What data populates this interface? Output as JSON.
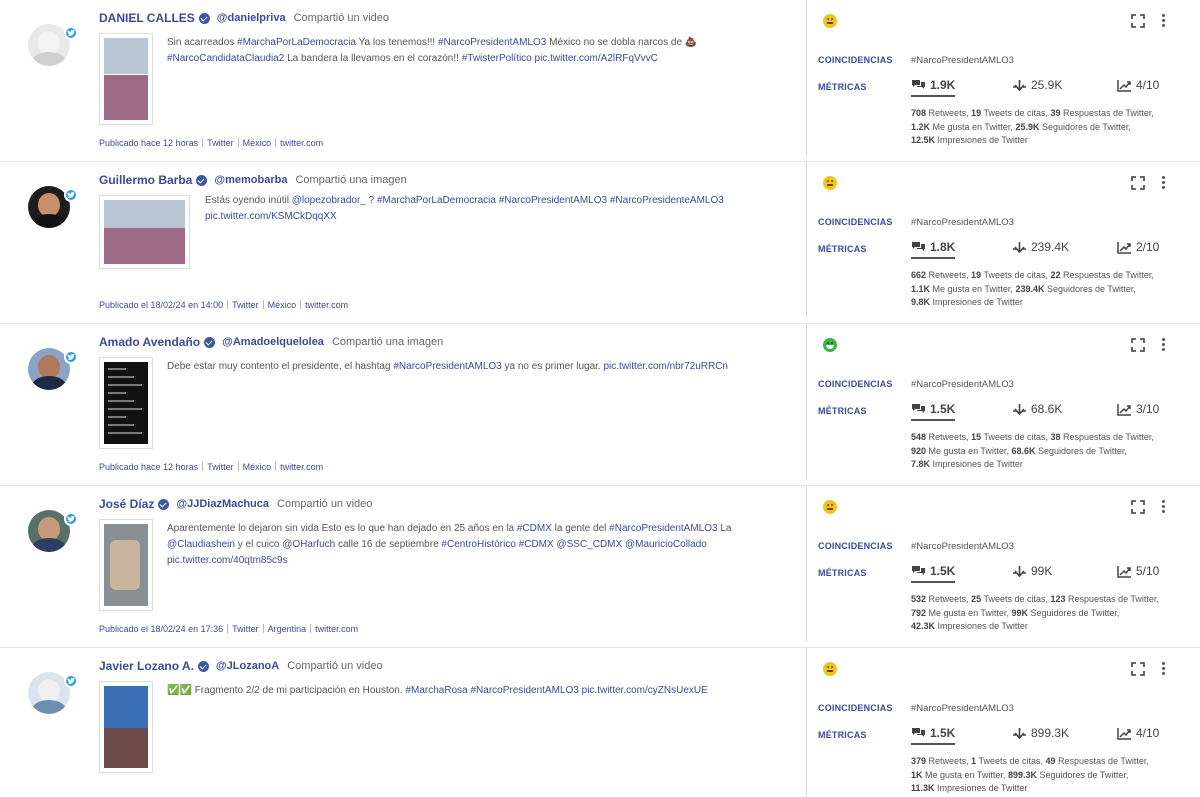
{
  "labels": {
    "coincidencias": "COINCIDENCIAS",
    "metricas": "MÉTRICAS",
    "retweets": "Retweets",
    "quotes": "Tweets de citas",
    "replies": "Respuestas de Twitter",
    "likes": "Me gusta en Twitter",
    "followers": "Seguidores de Twitter",
    "impressions": "Impresiones de Twitter"
  },
  "icons": {
    "comments": "comments-icon",
    "reach": "reach-icon",
    "trend": "trend-icon",
    "expand": "expand-icon",
    "menu": "more-vertical-icon"
  },
  "posts": [
    {
      "author": "DANIEL CALLES",
      "handle": "@danielpriva",
      "action": "Compartió un video",
      "text": "Sin acarreados #MarchaPorLaDemocracia Ya los tenemos!!! #NarcoPresidentAMLO3 México no se dobla narcos de 💩 #NarcoCandidataClaudia2 La bandera la llevamos en el corazón!! #TwisterPolítico pic.twitter.com/A2lRFqVvvC",
      "published": "Publicado hace 12 horas",
      "source": "Twitter",
      "country": "México",
      "domain": "twitter.com",
      "sentiment": "neutral",
      "coincidence": "#NarcoPresidentAMLO3",
      "comments": "1.9K",
      "reach": "25.9K",
      "score": "4/10",
      "retweets": "708",
      "quotes": "19",
      "replies": "39",
      "likes": "1.2K",
      "followers": "25.9K",
      "impressions": "12.5K"
    },
    {
      "author": "Guillermo Barba",
      "handle": "@memobarba",
      "action": "Compartió una imagen",
      "text": "Estás oyendo inútil @lopezobrador_ ? #MarchaPorLaDemocracia #NarcoPresidentAMLO3 #NarcoPresidenteAMLO3 pic.twitter.com/KSMCkDqqXX",
      "published": "Publicado el 18/02/24 en 14:00",
      "source": "Twitter",
      "country": "México",
      "domain": "twitter.com",
      "sentiment": "neutral",
      "coincidence": "#NarcoPresidentAMLO3",
      "comments": "1.8K",
      "reach": "239.4K",
      "score": "2/10",
      "retweets": "662",
      "quotes": "19",
      "replies": "22",
      "likes": "1.1K",
      "followers": "239.4K",
      "impressions": "9.8K"
    },
    {
      "author": "Amado Avendaño",
      "handle": "@Amadoelquelolea",
      "action": "Compartió una imagen",
      "text": "Debe estar muy contento el presidente, el hashtag #NarcoPresidentAMLO3 ya no es primer lugar. pic.twitter.com/nbr72uRRCn",
      "published": "Publicado hace 12 horas",
      "source": "Twitter",
      "country": "México",
      "domain": "twitter.com",
      "sentiment": "positive",
      "coincidence": "#NarcoPresidentAMLO3",
      "comments": "1.5K",
      "reach": "68.6K",
      "score": "3/10",
      "retweets": "548",
      "quotes": "15",
      "replies": "38",
      "likes": "920",
      "followers": "68.6K",
      "impressions": "7.8K"
    },
    {
      "author": "José Díaz",
      "handle": "@JJDiazMachuca",
      "action": "Compartió un video",
      "text": "Aparentemente lo dejaron sin vida Esto es lo que han dejado en 25 años en la #CDMX la gente del #NarcoPresidentAMLO3 La @Claudiashein y el cuico @OHarfuch calle 16 de septiembre #CentroHistórico #CDMX @SSC_CDMX @MauricioCollado pic.twitter.com/40qtm85c9s",
      "published": "Publicado el 18/02/24 en 17:36",
      "source": "Twitter",
      "country": "Argentina",
      "domain": "twitter.com",
      "sentiment": "neutral",
      "coincidence": "#NarcoPresidentAMLO3",
      "comments": "1.5K",
      "reach": "99K",
      "score": "5/10",
      "retweets": "532",
      "quotes": "25",
      "replies": "123",
      "likes": "792",
      "followers": "99K",
      "impressions": "42.3K"
    },
    {
      "author": "Javier Lozano A.",
      "handle": "@JLozanoA",
      "action": "Compartió un video",
      "text": "✅✅ Fragmento 2/2 de mi participación en Houston. #MarchaRosa #NarcoPresidentAMLO3 pic.twitter.com/cyZNsUexUE",
      "published": "",
      "source": "",
      "country": "",
      "domain": "",
      "sentiment": "neutral",
      "coincidence": "#NarcoPresidentAMLO3",
      "comments": "1.5K",
      "reach": "899.3K",
      "score": "4/10",
      "retweets": "379",
      "quotes": "1",
      "replies": "49",
      "likes": "1K",
      "followers": "899.3K",
      "impressions": "11.3K"
    }
  ]
}
